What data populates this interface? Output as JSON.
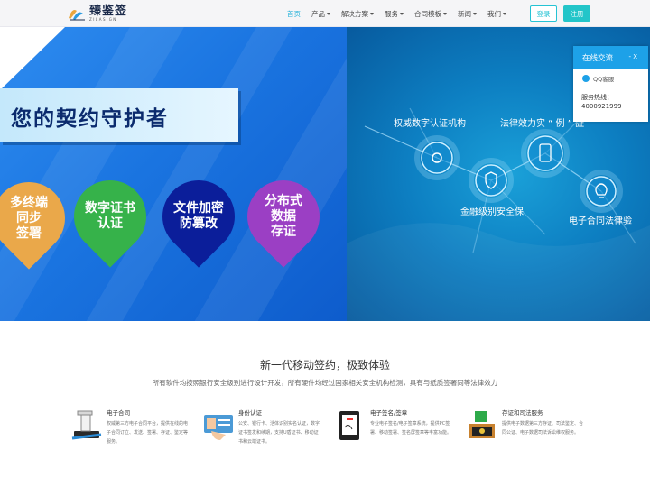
{
  "header": {
    "logo": {
      "name": "臻鉴签",
      "tagline": "ZILASIGN"
    },
    "nav": [
      {
        "label": "首页",
        "active": true,
        "has_menu": false
      },
      {
        "label": "产品",
        "active": false,
        "has_menu": true
      },
      {
        "label": "解决方案",
        "active": false,
        "has_menu": true
      },
      {
        "label": "服务",
        "active": false,
        "has_menu": true
      },
      {
        "label": "合同模板",
        "active": false,
        "has_menu": true
      },
      {
        "label": "新闻",
        "active": false,
        "has_menu": true
      },
      {
        "label": "我们",
        "active": false,
        "has_menu": true
      }
    ],
    "login_label": "登录",
    "register_label": "注册"
  },
  "banner": {
    "slogan": "您的契约守护者",
    "pins": [
      {
        "text": "多终端\n同步\n签署",
        "color": "#eaa84a"
      },
      {
        "text": "数字证书\n认证",
        "color": "#36b24a"
      },
      {
        "text": "文件加密\n防篡改",
        "color": "#0b1e9a"
      },
      {
        "text": "分布式\n数据\n存证",
        "color": "#9b3fc4"
      }
    ],
    "features": [
      {
        "label": "权威数字认证机构",
        "icon": "gear-icon"
      },
      {
        "label": "法律效力实 “ 例 ” 証",
        "icon": "phone-icon"
      },
      {
        "label": "金融级别安全保",
        "icon": "shield-icon"
      },
      {
        "label": "电子合同法律验",
        "icon": "bulb-icon"
      }
    ],
    "active_slide": 2,
    "slide_count": 3
  },
  "chat": {
    "title": "在线交流",
    "controls": "- X",
    "qq_label": "QQ客服",
    "hotline_label": "服务热线：",
    "hotline_number": "4000921999"
  },
  "intro": {
    "title": "新一代移动签约，极致体验",
    "subtitle": "所有软件均按照银行安全级别进行设计开发，所有硬件均经过国家相关安全机构检测，具有与纸质签署同等法律效力"
  },
  "services": [
    {
      "title": "电子合同",
      "desc": "权威第三方电子合同平台，提供在线的电子合同订立、发送、签署、存证、鉴定等服务。",
      "icon": "stamp-icon"
    },
    {
      "title": "身份认证",
      "desc": "公安、银行卡、活体识别实名认证，数字证书签发和续期，支持U盾证书、移动证书和云端证书。",
      "icon": "id-card-icon"
    },
    {
      "title": "电子签名/签章",
      "desc": "专业电子签名/电子签章系统，提供PC签署、移动签署、签名屏签章等丰富功能。",
      "icon": "tablet-icon"
    },
    {
      "title": "存证和司法服务",
      "desc": "提供电子数据第三方存证、司法鉴定、合同公证、电子数据司法诉讼维权服务。",
      "icon": "archive-icon"
    }
  ]
}
